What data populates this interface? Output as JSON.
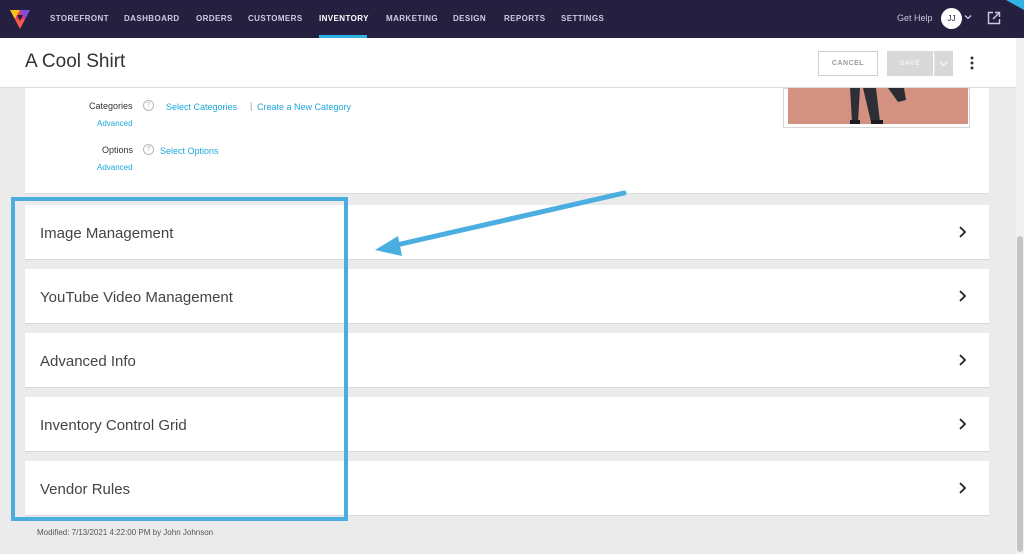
{
  "nav": {
    "items": [
      {
        "label": "STOREFRONT"
      },
      {
        "label": "DASHBOARD"
      },
      {
        "label": "ORDERS"
      },
      {
        "label": "CUSTOMERS"
      },
      {
        "label": "INVENTORY"
      },
      {
        "label": "MARKETING"
      },
      {
        "label": "DESIGN"
      },
      {
        "label": "REPORTS"
      },
      {
        "label": "SETTINGS"
      }
    ],
    "active": "INVENTORY",
    "get_help": "Get Help",
    "avatar_initials": "JJ"
  },
  "header": {
    "title": "A Cool Shirt",
    "cancel_label": "CANCEL",
    "save_label": "SAVE"
  },
  "details": {
    "categories_label": "Categories",
    "select_categories": "Select Categories",
    "separator": "|",
    "create_category": "Create a New Category",
    "categories_advanced": "Advanced",
    "options_label": "Options",
    "select_options": "Select Options",
    "options_advanced": "Advanced",
    "help_glyph": "?"
  },
  "sections": [
    {
      "label": "Image Management"
    },
    {
      "label": "YouTube Video Management"
    },
    {
      "label": "Advanced Info"
    },
    {
      "label": "Inventory Control Grid"
    },
    {
      "label": "Vendor Rules"
    }
  ],
  "footer": {
    "modified": "Modified: 7/13/2021 4:22:00 PM by John Johnson"
  },
  "colors": {
    "nav_bg": "#262040",
    "accent": "#2fb3e6",
    "link": "#1ea7dc",
    "annotation": "#4aaee0"
  },
  "icons": [
    "logo-icon",
    "user-menu-chevron-icon",
    "external-link-icon",
    "more-options-icon",
    "help-icon",
    "chevron-right-icon"
  ]
}
